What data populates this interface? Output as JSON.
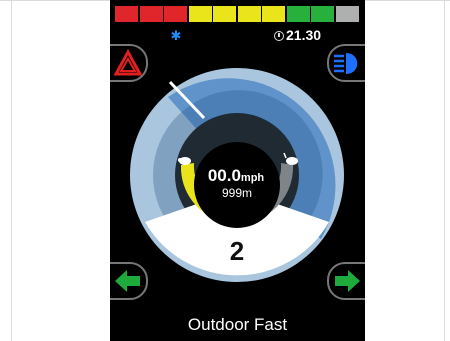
{
  "battery": {
    "segment_colors": [
      "#e0262b",
      "#e0262b",
      "#e0262b",
      "#e9e51a",
      "#e9e51a",
      "#e9e51a",
      "#e9e51a",
      "#27b03c",
      "#27b03c",
      "#aeb0b0"
    ]
  },
  "status": {
    "bluetooth_icon": "bluetooth-icon",
    "time": "21.30"
  },
  "buttons": {
    "hazard": "hazard-warning-icon",
    "lights": "headlight-icon",
    "left": "left-arrow-icon",
    "right": "right-arrow-icon"
  },
  "speed": {
    "value": "00.0",
    "unit": "mph",
    "distance": "999m"
  },
  "speed_setting": "2",
  "mode": "Outdoor Fast",
  "colors": {
    "arc_blue": "#5f93c9",
    "arc_light": "#a9c6de",
    "gauge_yellow": "#e9e51a",
    "gauge_grey": "#7f8489",
    "hazard_red": "#e02020",
    "arrow_green": "#1faa3c",
    "light_blue": "#1f6fff"
  }
}
